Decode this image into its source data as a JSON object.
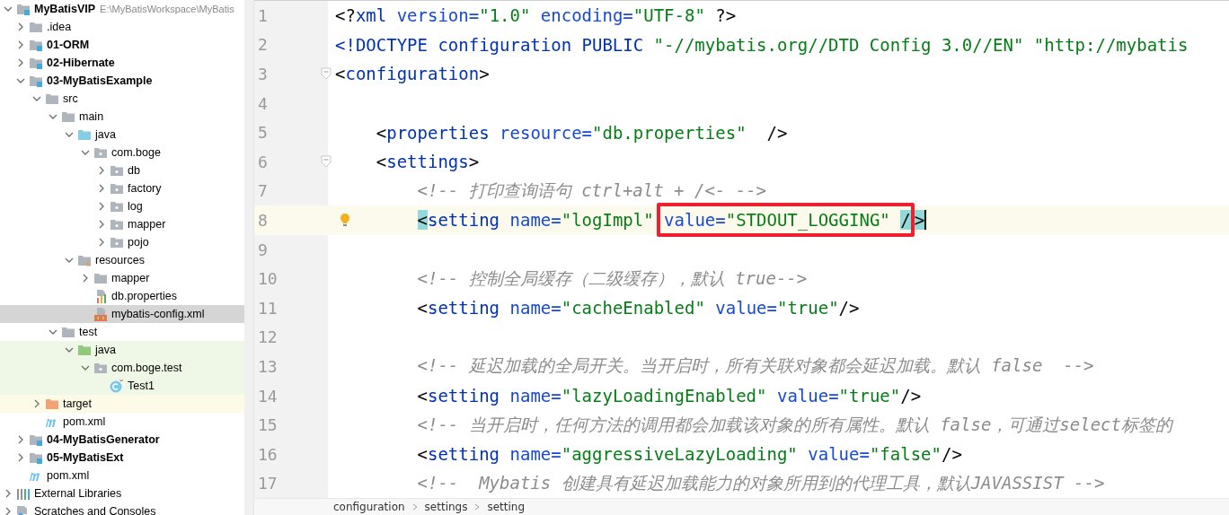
{
  "project_tree": [
    {
      "name": "MyBatisVIP",
      "path": "E:\\MyBatisWorkspace\\MyBatis",
      "kind": "module",
      "expanded": true,
      "selected": false,
      "children": [
        {
          "name": ".idea",
          "kind": "folder",
          "expanded": false,
          "selected": false
        },
        {
          "name": "01-ORM",
          "kind": "module",
          "expanded": false,
          "selected": false
        },
        {
          "name": "02-Hibernate",
          "kind": "module",
          "expanded": false,
          "selected": false
        },
        {
          "name": "03-MyBatisExample",
          "kind": "module",
          "expanded": true,
          "selected": false,
          "children": [
            {
              "name": "src",
              "kind": "folder",
              "expanded": true,
              "selected": false,
              "children": [
                {
                  "name": "main",
                  "kind": "folder",
                  "expanded": true,
                  "selected": false,
                  "children": [
                    {
                      "name": "java",
                      "kind": "source-folder",
                      "expanded": true,
                      "selected": false,
                      "children": [
                        {
                          "name": "com.boge",
                          "kind": "package",
                          "expanded": true,
                          "selected": false,
                          "children": [
                            {
                              "name": "db",
                              "kind": "package",
                              "expanded": false,
                              "selected": false
                            },
                            {
                              "name": "factory",
                              "kind": "package",
                              "expanded": false,
                              "selected": false
                            },
                            {
                              "name": "log",
                              "kind": "package",
                              "expanded": false,
                              "selected": false
                            },
                            {
                              "name": "mapper",
                              "kind": "package",
                              "expanded": false,
                              "selected": false
                            },
                            {
                              "name": "pojo",
                              "kind": "package",
                              "expanded": false,
                              "selected": false
                            }
                          ]
                        }
                      ]
                    },
                    {
                      "name": "resources",
                      "kind": "resources",
                      "expanded": true,
                      "selected": false,
                      "children": [
                        {
                          "name": "mapper",
                          "kind": "folder",
                          "expanded": false,
                          "selected": false
                        },
                        {
                          "name": "db.properties",
                          "kind": "properties-file",
                          "selected": false
                        },
                        {
                          "name": "mybatis-config.xml",
                          "kind": "xml-file",
                          "selected": true
                        }
                      ]
                    }
                  ]
                },
                {
                  "name": "test",
                  "kind": "folder",
                  "expanded": true,
                  "selected": false,
                  "children": [
                    {
                      "name": "java",
                      "kind": "test-folder",
                      "expanded": true,
                      "selected": false,
                      "children": [
                        {
                          "name": "com.boge.test",
                          "kind": "package",
                          "expanded": true,
                          "selected": false,
                          "children": [
                            {
                              "name": "Test1",
                              "kind": "class",
                              "selected": false
                            }
                          ]
                        }
                      ]
                    }
                  ]
                }
              ]
            },
            {
              "name": "target",
              "kind": "excluded",
              "expanded": false,
              "selected": false
            },
            {
              "name": "pom.xml",
              "kind": "maven-file",
              "selected": false
            }
          ]
        },
        {
          "name": "04-MyBatisGenerator",
          "kind": "module",
          "expanded": false,
          "selected": false
        },
        {
          "name": "05-MyBatisExt",
          "kind": "module",
          "expanded": false,
          "selected": false
        },
        {
          "name": "pom.xml",
          "kind": "maven-file",
          "selected": false
        }
      ]
    },
    {
      "name": "External Libraries",
      "kind": "libraries",
      "expanded": false,
      "selected": false
    },
    {
      "name": "Scratches and Consoles",
      "kind": "scratches",
      "expanded": false,
      "selected": false
    }
  ],
  "editor": {
    "lines": [
      {
        "number": "1",
        "current": false,
        "intention": false,
        "fold": false,
        "tokens": [
          {
            "text": "<?",
            "kind": "punct"
          },
          {
            "text": "xml",
            "kind": "tag"
          },
          {
            "text": " version=",
            "kind": "attr"
          },
          {
            "text": "\"1.0\"",
            "kind": "string"
          },
          {
            "text": " encoding=",
            "kind": "attr"
          },
          {
            "text": "\"UTF-8\"",
            "kind": "string"
          },
          {
            "text": " ?>",
            "kind": "punct"
          }
        ]
      },
      {
        "number": "2",
        "current": false,
        "intention": false,
        "fold": false,
        "tokens": [
          {
            "text": "<!DOCTYPE configuration PUBLIC ",
            "kind": "tag"
          },
          {
            "text": "\"-//mybatis.org//DTD Config 3.0//EN\" \"http://mybatis",
            "kind": "string"
          }
        ]
      },
      {
        "number": "3",
        "current": false,
        "intention": false,
        "fold": true,
        "tokens": [
          {
            "text": "<",
            "kind": "punct"
          },
          {
            "text": "configuration",
            "kind": "tag"
          },
          {
            "text": ">",
            "kind": "punct"
          }
        ]
      },
      {
        "number": "4",
        "current": false,
        "intention": false,
        "fold": false
      },
      {
        "number": "5",
        "current": false,
        "intention": false,
        "fold": false,
        "tokens": [
          {
            "text": "    <",
            "kind": "punct"
          },
          {
            "text": "properties",
            "kind": "tag"
          },
          {
            "text": " resource=",
            "kind": "attr"
          },
          {
            "text": "\"db.properties\"",
            "kind": "string"
          },
          {
            "text": "  />",
            "kind": "punct"
          }
        ]
      },
      {
        "number": "6",
        "current": false,
        "intention": false,
        "fold": true,
        "tokens": [
          {
            "text": "    <",
            "kind": "punct"
          },
          {
            "text": "settings",
            "kind": "tag"
          },
          {
            "text": ">",
            "kind": "punct"
          }
        ]
      },
      {
        "number": "7",
        "current": false,
        "intention": false,
        "fold": false,
        "tokens": [
          {
            "text": "        <!-- 打印查询语句 ctrl+alt + /<- -->",
            "kind": "comment"
          }
        ]
      },
      {
        "number": "8",
        "current": true,
        "intention": true,
        "fold": false,
        "tokens": [
          {
            "text": "        <",
            "kind": "punct",
            "match": true
          },
          {
            "text": "setting",
            "kind": "tag"
          },
          {
            "text": " name=",
            "kind": "attr"
          },
          {
            "text": "\"logImpl\" ",
            "kind": "string"
          },
          {
            "kind": "box",
            "children": [
              {
                "text": "value=",
                "kind": "attr"
              },
              {
                "text": "\"STDOUT_LOGGING\" ",
                "kind": "string"
              },
              {
                "text": "/",
                "kind": "punct",
                "match": true
              }
            ]
          },
          {
            "text": ">",
            "kind": "punct",
            "match": true
          }
        ]
      },
      {
        "number": "9",
        "current": false,
        "intention": false,
        "fold": false
      },
      {
        "number": "10",
        "current": false,
        "intention": false,
        "fold": false,
        "tokens": [
          {
            "text": "        <!-- 控制全局缓存（二级缓存），默认 true-->",
            "kind": "comment"
          }
        ]
      },
      {
        "number": "11",
        "current": false,
        "intention": false,
        "fold": false,
        "tokens": [
          {
            "text": "        <",
            "kind": "punct"
          },
          {
            "text": "setting",
            "kind": "tag"
          },
          {
            "text": " name=",
            "kind": "attr"
          },
          {
            "text": "\"cacheEnabled\"",
            "kind": "string"
          },
          {
            "text": " value=",
            "kind": "attr"
          },
          {
            "text": "\"true\"",
            "kind": "string"
          },
          {
            "text": "/>",
            "kind": "punct"
          }
        ]
      },
      {
        "number": "12",
        "current": false,
        "intention": false,
        "fold": false
      },
      {
        "number": "13",
        "current": false,
        "intention": false,
        "fold": false,
        "tokens": [
          {
            "text": "        <!-- 延迟加载的全局开关。当开启时，所有关联对象都会延迟加载。默认 false  -->",
            "kind": "comment"
          }
        ]
      },
      {
        "number": "14",
        "current": false,
        "intention": false,
        "fold": false,
        "tokens": [
          {
            "text": "        <",
            "kind": "punct"
          },
          {
            "text": "setting",
            "kind": "tag"
          },
          {
            "text": " name=",
            "kind": "attr"
          },
          {
            "text": "\"lazyLoadingEnabled\"",
            "kind": "string"
          },
          {
            "text": " value=",
            "kind": "attr"
          },
          {
            "text": "\"true\"",
            "kind": "string"
          },
          {
            "text": "/>",
            "kind": "punct"
          }
        ]
      },
      {
        "number": "15",
        "current": false,
        "intention": false,
        "fold": false,
        "tokens": [
          {
            "text": "        <!-- 当开启时，任何方法的调用都会加载该对象的所有属性。默认 false，可通过select标签的",
            "kind": "comment"
          }
        ]
      },
      {
        "number": "16",
        "current": false,
        "intention": false,
        "fold": false,
        "tokens": [
          {
            "text": "        <",
            "kind": "punct"
          },
          {
            "text": "setting",
            "kind": "tag"
          },
          {
            "text": " name=",
            "kind": "attr"
          },
          {
            "text": "\"aggressiveLazyLoading\"",
            "kind": "string"
          },
          {
            "text": " value=",
            "kind": "attr"
          },
          {
            "text": "\"false\"",
            "kind": "string"
          },
          {
            "text": "/>",
            "kind": "punct"
          }
        ]
      },
      {
        "number": "17",
        "current": false,
        "intention": false,
        "fold": false,
        "tokens": [
          {
            "text": "        <!--  Mybatis 创建具有延迟加载能力的对象所用到的代理工具，默认JAVASSIST -->",
            "kind": "comment"
          }
        ]
      }
    ],
    "breadcrumbs": [
      "configuration",
      "settings",
      "setting"
    ]
  }
}
